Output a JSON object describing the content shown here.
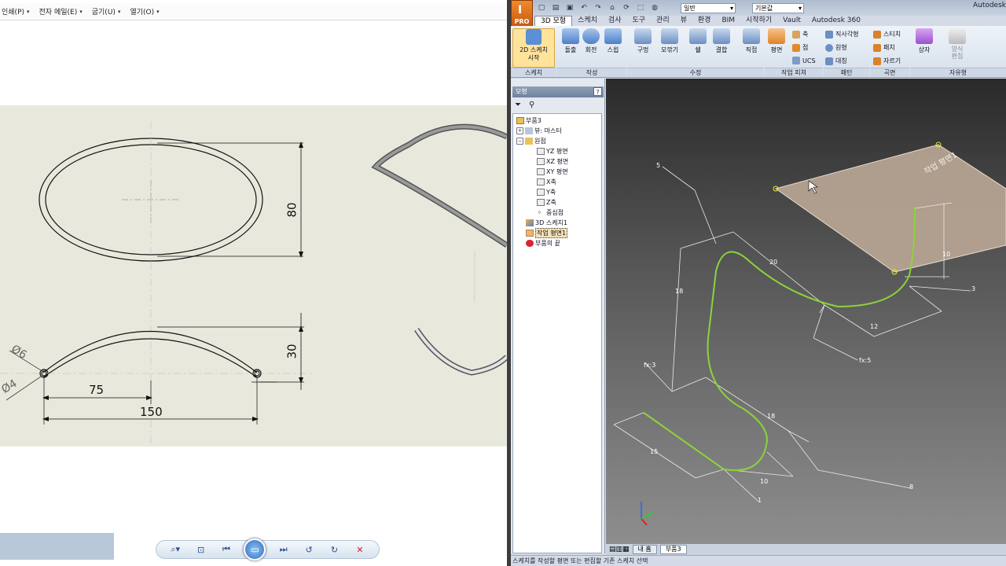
{
  "left_menu": [
    {
      "label": "인쇄(P)"
    },
    {
      "label": "전자 메일(E)"
    },
    {
      "label": "굽기(U)"
    },
    {
      "label": "열기(O)"
    }
  ],
  "drawing": {
    "dims": {
      "height_top": "80",
      "height_bottom": "30",
      "half_width": "75",
      "width": "150",
      "dia_outer": "Ø6",
      "dia_inner": "Ø4"
    }
  },
  "viewer_toolbar": [
    {
      "icon": "zoom-icon"
    },
    {
      "icon": "fit-icon"
    },
    {
      "icon": "previous-icon"
    },
    {
      "icon": "slideshow-icon"
    },
    {
      "icon": "next-icon"
    },
    {
      "icon": "rotate-left-icon"
    },
    {
      "icon": "rotate-right-icon"
    },
    {
      "icon": "delete-icon"
    }
  ],
  "inventor": {
    "app_label": "PRO",
    "appearance_dropdown": "일반",
    "style_dropdown": "기본값",
    "app_title": "Autodesk",
    "tabs": [
      "3D 모형",
      "스케치",
      "검사",
      "도구",
      "관리",
      "뷰",
      "환경",
      "BIM",
      "시작하기",
      "Vault",
      "Autodesk 360"
    ],
    "ribbon": {
      "sketch_btn": "2D 스케치\n시작",
      "extrude": "돌출",
      "revolve": "회전",
      "sweep": "스윕",
      "hole": "구멍",
      "fillet": "모깎기",
      "shell": "쉘",
      "combine": "결합",
      "direct": "직접",
      "plane": "평면",
      "axis": "축",
      "point": "점",
      "ucs": "UCS",
      "rect_pattern": "직사각형",
      "circ_pattern": "원형",
      "mirror": "대칭",
      "stitch": "스티치",
      "patch": "패치",
      "trim": "자르기",
      "box": "상자",
      "freeform_edit": "양식\n편집",
      "groups": {
        "sketch": "스케치",
        "create": "작성",
        "modify": "수정",
        "work_features": "작업 피쳐",
        "pattern": "패턴",
        "surface": "곡면",
        "freeform": "자유형"
      }
    },
    "browser": {
      "header": "모형",
      "help": "?",
      "tree": [
        {
          "label": "부품3",
          "level": 0
        },
        {
          "label": "뷰: 마스터",
          "level": 1
        },
        {
          "label": "원점",
          "level": 1
        },
        {
          "label": "YZ 평면",
          "level": 2
        },
        {
          "label": "XZ 평면",
          "level": 2
        },
        {
          "label": "XY 평면",
          "level": 2
        },
        {
          "label": "X축",
          "level": 2
        },
        {
          "label": "Y축",
          "level": 2
        },
        {
          "label": "Z축",
          "level": 2
        },
        {
          "label": "중심점",
          "level": 2
        },
        {
          "label": "3D 스케치1",
          "level": 1
        },
        {
          "label": "작업 평면1",
          "level": 1
        },
        {
          "label": "부품의 끝",
          "level": 1
        }
      ]
    },
    "viewport": {
      "dims": [
        "5",
        "20",
        "18",
        "10",
        "3",
        "12",
        "fx:3",
        "fx:5",
        "18",
        "15",
        "10",
        "1",
        "8"
      ],
      "plane_label": "작업 평면1"
    },
    "doc_tabs": [
      "내 홈",
      "부품3"
    ],
    "status": "스케치를 작성할 평면 또는 편집할 기존 스케치 선택"
  }
}
